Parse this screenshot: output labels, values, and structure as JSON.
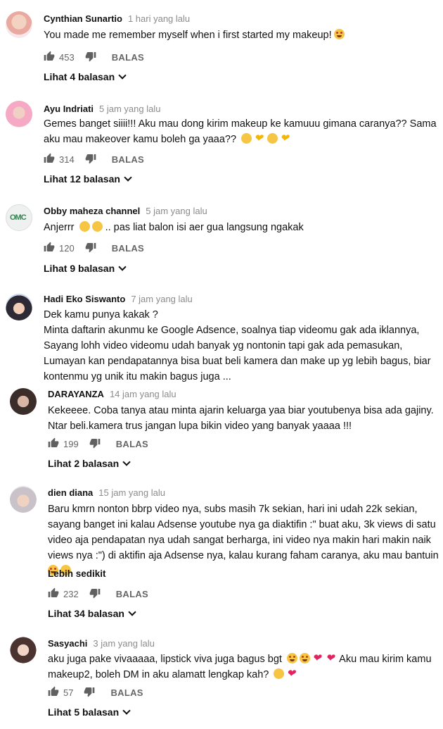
{
  "labels": {
    "reply": "BALAS"
  },
  "comments": [
    {
      "author": "Cynthian Sunartio",
      "time": "1 hari yang lalu",
      "lines": [
        "You made me remember myself when i first started my makeup!"
      ],
      "likes": "453",
      "replies": "Lihat 4 balasan"
    },
    {
      "author": "Ayu Indriati",
      "time": "5 jam yang lalu",
      "lines": [
        "Gemes banget siiii!!! Aku mau dong kirim makeup ke kamuuu gimana caranya?? Sama",
        "aku mau makeover kamu boleh ga yaaa??"
      ],
      "likes": "314",
      "replies": "Lihat 12 balasan"
    },
    {
      "author": "Obby maheza channel",
      "time": "5 jam yang lalu",
      "lines": [
        "Anjerrr",
        ".. pas liat balon isi aer gua langsung ngakak"
      ],
      "likes": "120",
      "replies": "Lihat 9 balasan"
    },
    {
      "author": "Hadi Eko Siswanto",
      "time": "7 jam yang lalu",
      "lines": [
        "Dek kamu punya kakak ?",
        "Minta daftarin akunmu ke Google Adsence, soalnya tiap videomu gak ada iklannya,",
        "Sayang lohh video videomu udah banyak yg nontonin tapi gak ada pemasukan,",
        "Lumayan kan pendapatannya bisa buat beli kamera dan make up yg lebih bagus, biar",
        "kontenmu yg unik itu makin bagus juga ..."
      ]
    },
    {
      "author": "DARAYANZA",
      "time": "14 jam yang lalu",
      "lines": [
        "Kekeeee. Coba tanya atau minta ajarin keluarga yaa biar youtubenya bisa ada gajiny.",
        "Ntar beli.kamera trus jangan lupa bikin video yang banyak yaaaa !!!"
      ],
      "likes": "199",
      "replies": "Lihat 2 balasan"
    },
    {
      "author": "dien diana",
      "time": "15 jam yang lalu",
      "lines": [
        "Baru kmrn nonton bbrp video nya, subs masih 7k sekian, hari ini udah 22k sekian,",
        "sayang banget ini kalau Adsense youtube nya ga diaktifin :\" buat aku, 3k views di satu",
        "video aja pendapatan nya udah sangat berharga, ini video nya makin hari makin naik",
        "views nya :\") di aktifin aja Adsense nya, kalau kurang faham caranya, aku mau bantuin"
      ],
      "more": "Lebih sedikit",
      "likes": "232",
      "replies": "Lihat 34 balasan"
    },
    {
      "author": "Sasyachi",
      "time": "3 jam yang lalu",
      "lines": [
        "aku juga pake vivaaaaa, lipstick viva juga bagus bgt",
        "Aku mau kirim kamu",
        "makeup2, boleh DM in aku alamatt lengkap kah?"
      ],
      "likes": "57",
      "replies": "Lihat 5 balasan"
    }
  ],
  "colors": {
    "text": "#111111",
    "meta": "#8c8c8c",
    "action": "#666666"
  }
}
